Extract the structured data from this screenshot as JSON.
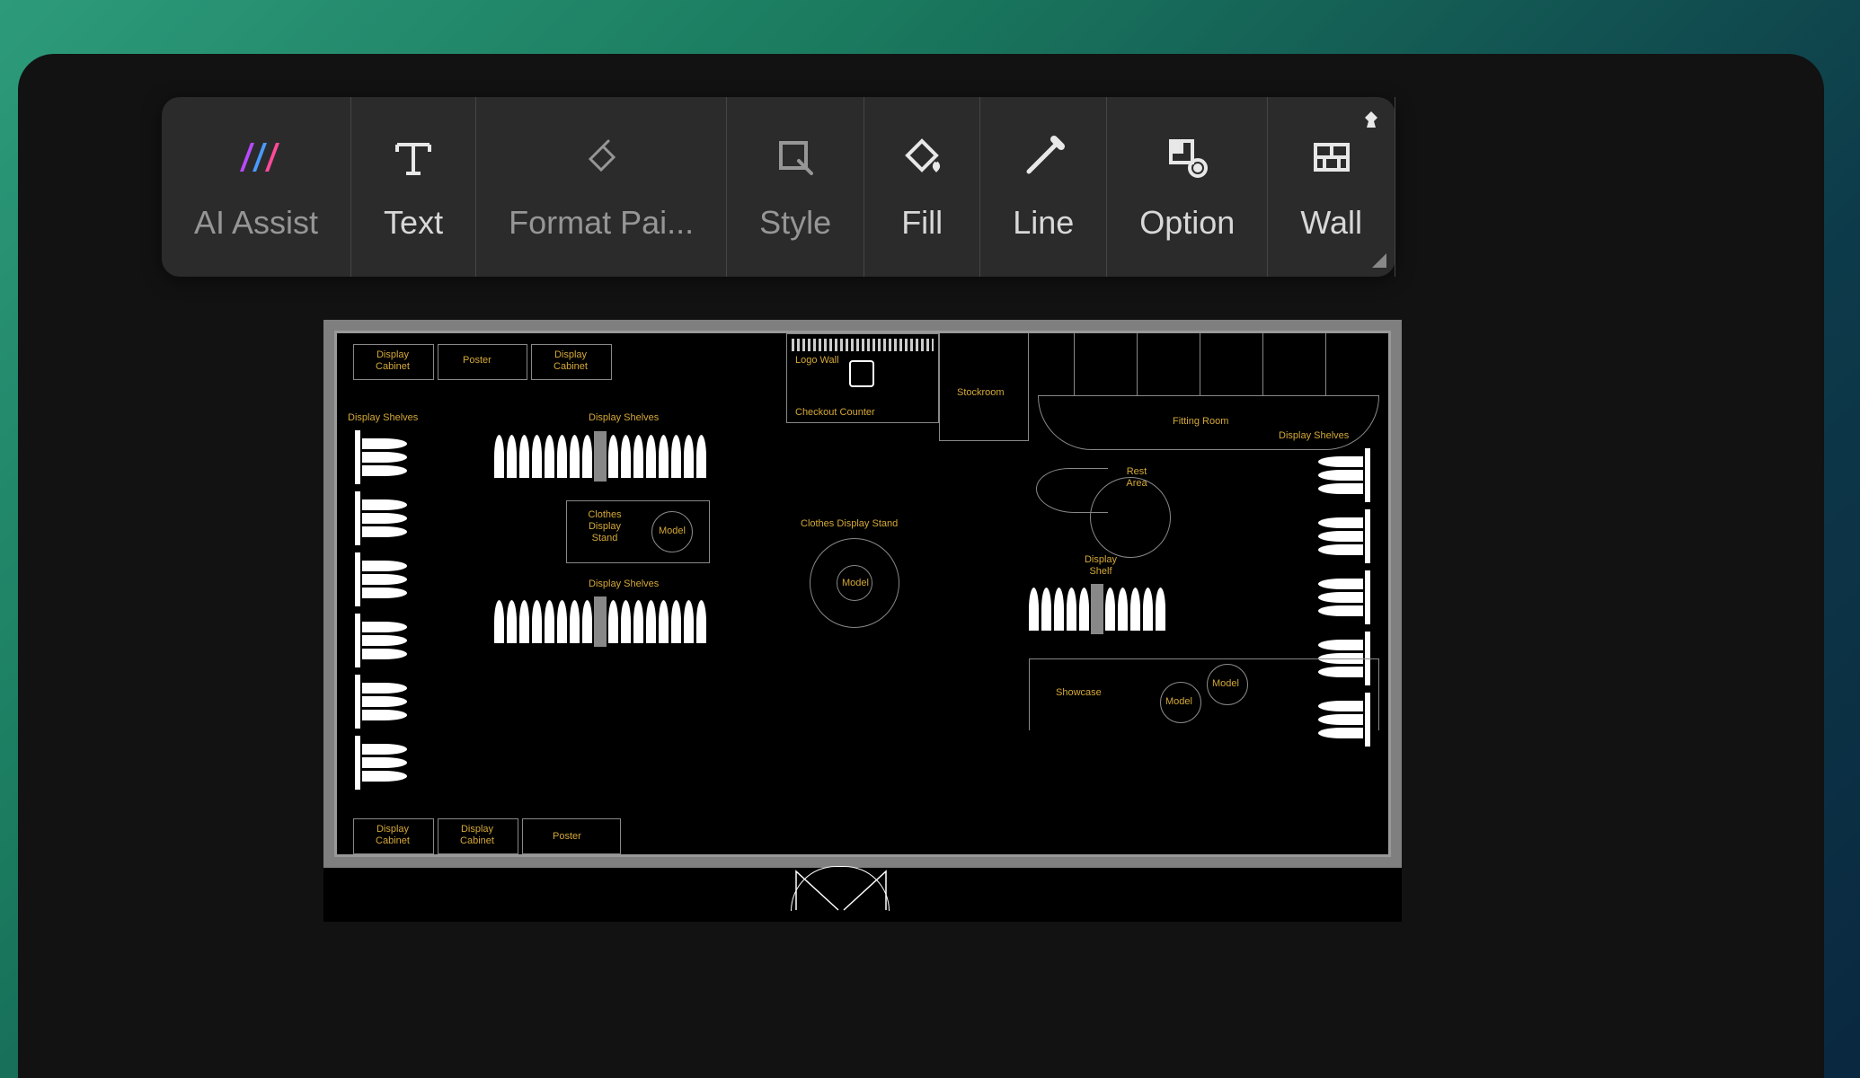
{
  "toolbar": {
    "items": [
      {
        "label": "AI Assist",
        "icon": "ai-assist-icon",
        "dim": true
      },
      {
        "label": "Text",
        "icon": "text-icon",
        "dim": false
      },
      {
        "label": "Format Pai...",
        "icon": "format-painter-icon",
        "dim": true
      },
      {
        "label": "Style",
        "icon": "style-icon",
        "dim": true
      },
      {
        "label": "Fill",
        "icon": "fill-icon",
        "dim": false
      },
      {
        "label": "Line",
        "icon": "line-icon",
        "dim": false
      },
      {
        "label": "Option",
        "icon": "option-icon",
        "dim": false
      },
      {
        "label": "Wall",
        "icon": "wall-icon",
        "dim": false
      }
    ]
  },
  "floorplan": {
    "labels": {
      "display_cabinet": "Display\nCabinet",
      "poster": "Poster",
      "logo_wall": "Logo Wall",
      "checkout_counter": "Checkout Counter",
      "stockroom": "Stockroom",
      "display_shelves": "Display Shelves",
      "fitting_room": "Fitting Room",
      "rest_area": "Rest\nArea",
      "clothes_display_stand": "Clothes\nDisplay\nStand",
      "clothes_display_stand2": "Clothes Display Stand",
      "model": "Model",
      "display_shelf": "Display\nShelf",
      "showcase": "Showcase"
    }
  }
}
